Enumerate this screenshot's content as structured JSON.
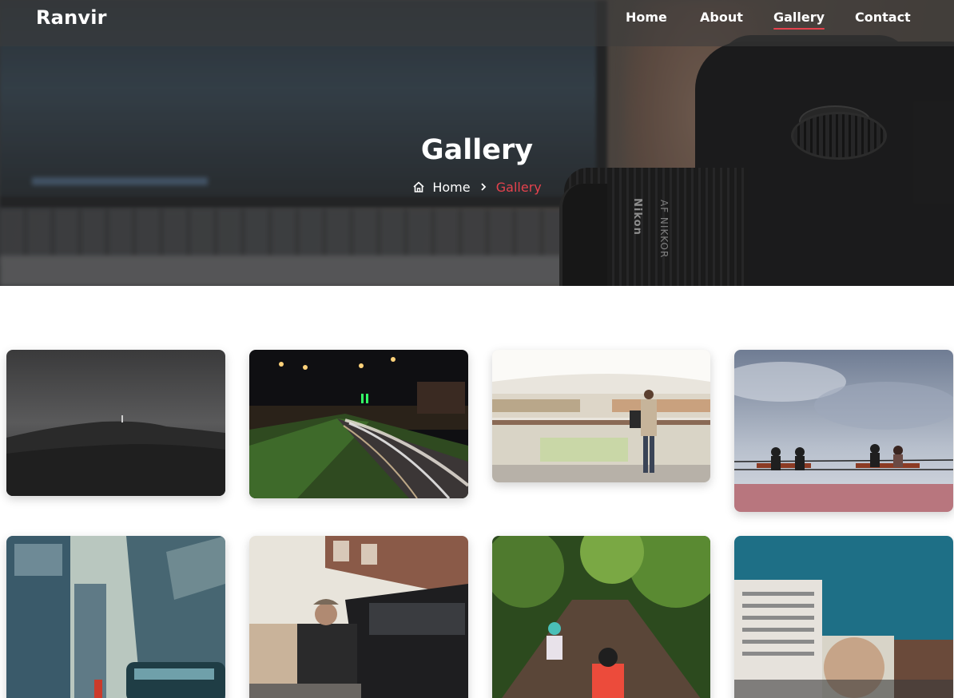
{
  "navbar": {
    "brand": "Ranvir",
    "links": [
      {
        "label": "Home",
        "active": false
      },
      {
        "label": "About",
        "active": false
      },
      {
        "label": "Gallery",
        "active": true
      },
      {
        "label": "Contact",
        "active": false
      }
    ]
  },
  "hero": {
    "title": "Gallery",
    "breadcrumb": {
      "home_icon": "home-icon",
      "home_label": "Home",
      "separator_icon": "chevron-right-icon",
      "current_label": "Gallery"
    },
    "camera_lens_text": [
      "Nikon",
      "AF NIKKOR"
    ]
  },
  "theme": {
    "accent": "#e5424d",
    "nav_text": "#ffffff"
  },
  "gallery": {
    "images": [
      {
        "subject": "dark hillside at dusk with lone figure"
      },
      {
        "subject": "night road with light trails and street lamps"
      },
      {
        "subject": "person standing at mall balcony railing"
      },
      {
        "subject": "people on benches by sea under cloudy sky"
      },
      {
        "subject": "city street with tram and tall buildings"
      },
      {
        "subject": "man with turban beside black taxi"
      },
      {
        "subject": "cyclists riding through green forest path"
      },
      {
        "subject": "building with graffiti wall under blue sky"
      }
    ]
  }
}
